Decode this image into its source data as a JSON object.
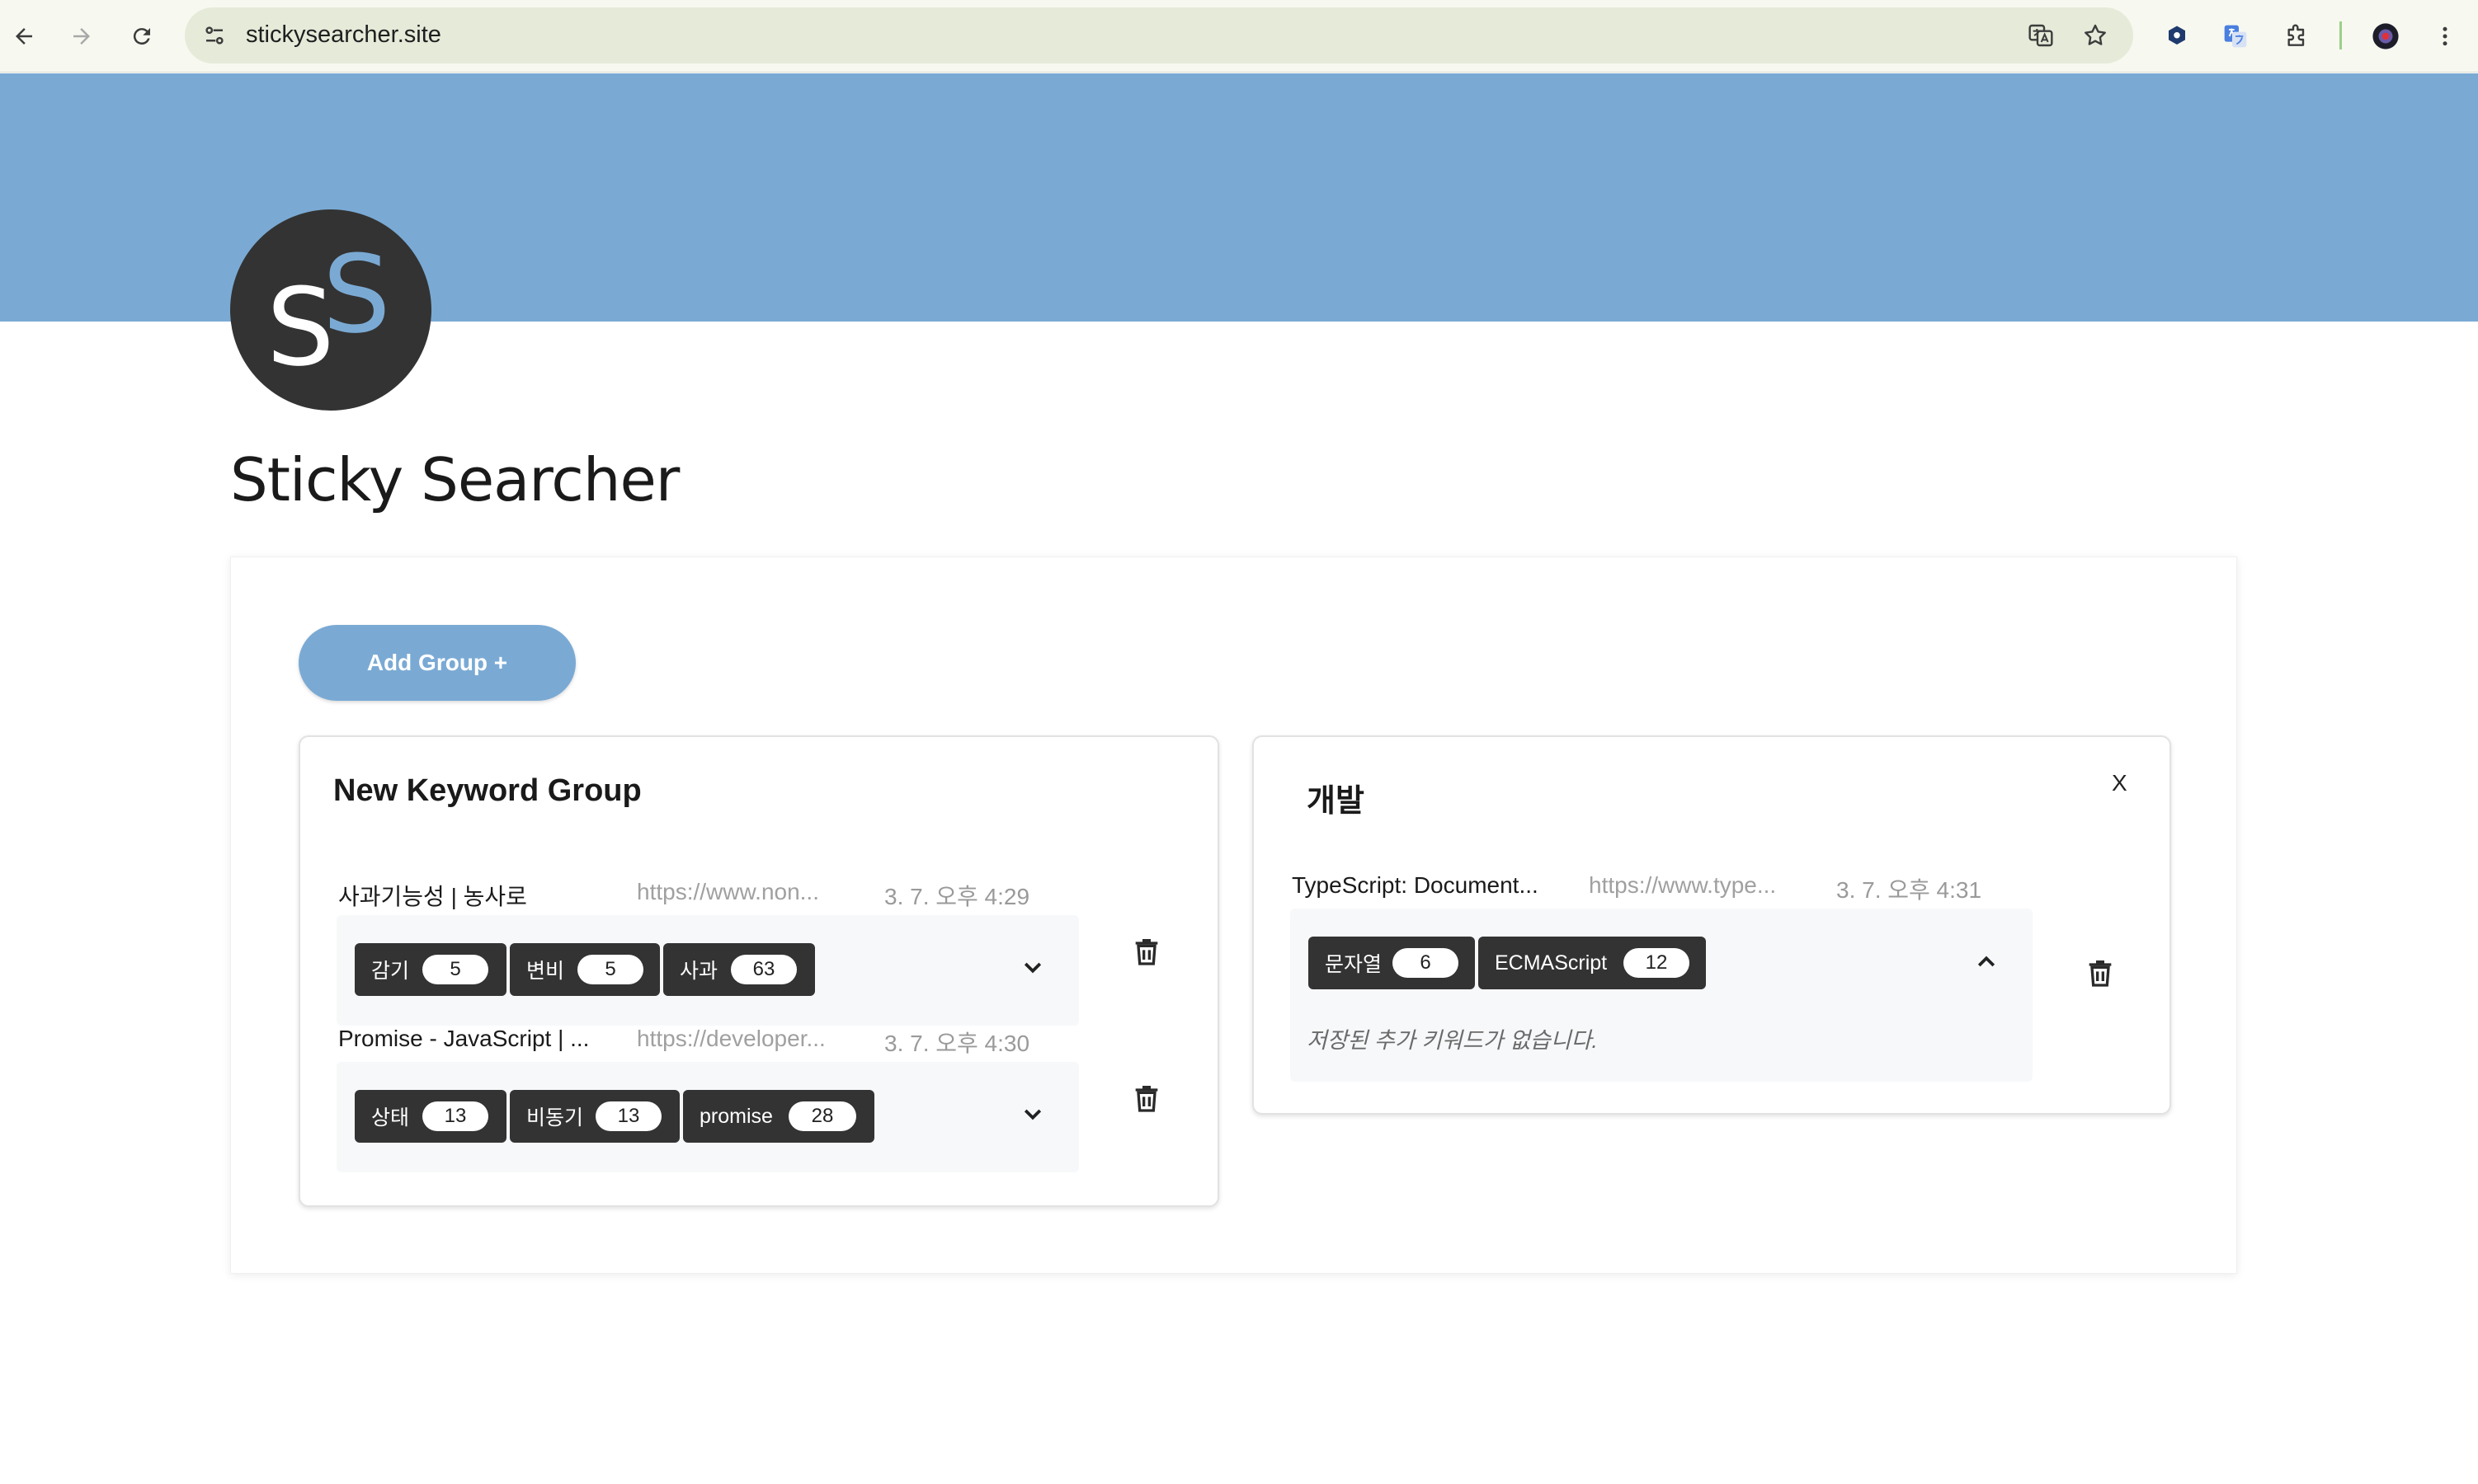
{
  "browser": {
    "url": "stickysearcher.site"
  },
  "app": {
    "title": "Sticky Searcher",
    "logo_letters": [
      "S",
      "S"
    ]
  },
  "toolbar": {
    "add_group_label": "Add Group +"
  },
  "groups": [
    {
      "title": "New Keyword Group",
      "entries": [
        {
          "title": "사과기능성 | 농사로",
          "url": "https://www.non...",
          "date": "3. 7. 오후 4:29",
          "keywords": [
            {
              "label": "감기",
              "count": "5"
            },
            {
              "label": "변비",
              "count": "5"
            },
            {
              "label": "사과",
              "count": "63"
            }
          ]
        },
        {
          "title": "Promise - JavaScript | ...",
          "url": "https://developer...",
          "date": "3. 7. 오후 4:30",
          "keywords": [
            {
              "label": "상태",
              "count": "13"
            },
            {
              "label": "비동기",
              "count": "13"
            },
            {
              "label": "promise",
              "count": "28"
            }
          ]
        }
      ]
    },
    {
      "title": "개발",
      "close_label": "X",
      "entries": [
        {
          "title": "TypeScript: Document...",
          "url": "https://www.type...",
          "date": "3. 7. 오후 4:31",
          "keywords": [
            {
              "label": "문자열",
              "count": "6"
            },
            {
              "label": "ECMAScript",
              "count": "12"
            }
          ],
          "expanded_message": "저장된 추가 키워드가 없습니다."
        }
      ]
    }
  ]
}
